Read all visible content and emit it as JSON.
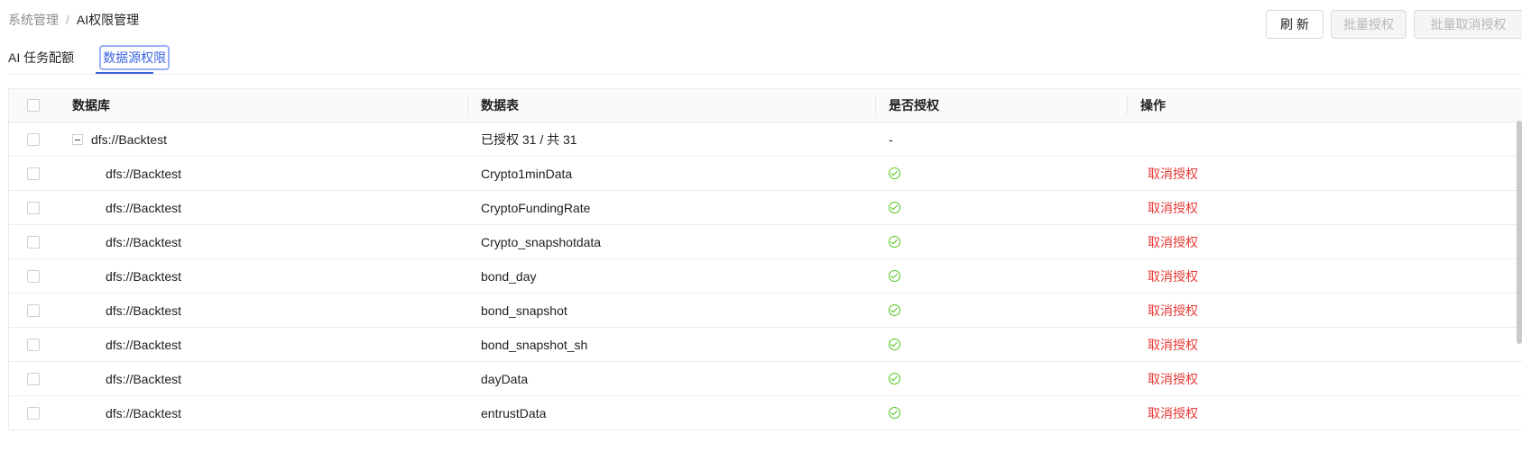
{
  "breadcrumb": {
    "parent": "系统管理",
    "separator": "/",
    "current": "AI权限管理"
  },
  "toolbar": {
    "refresh_label": "刷 新",
    "batch_grant_label": "批量授权",
    "batch_revoke_label": "批量取消授权"
  },
  "tabs": [
    {
      "label": "AI 任务配额",
      "active": false
    },
    {
      "label": "数据源权限",
      "active": true
    }
  ],
  "table": {
    "headers": {
      "database": "数据库",
      "table": "数据表",
      "authorized": "是否授权",
      "operation": "操作"
    },
    "group": {
      "database": "dfs://Backtest",
      "summary": "已授权 31 / 共 31",
      "authorized": "-"
    },
    "rows": [
      {
        "database": "dfs://Backtest",
        "table": "Crypto1minData",
        "op": "取消授权"
      },
      {
        "database": "dfs://Backtest",
        "table": "CryptoFundingRate",
        "op": "取消授权"
      },
      {
        "database": "dfs://Backtest",
        "table": "Crypto_snapshotdata",
        "op": "取消授权"
      },
      {
        "database": "dfs://Backtest",
        "table": "bond_day",
        "op": "取消授权"
      },
      {
        "database": "dfs://Backtest",
        "table": "bond_snapshot",
        "op": "取消授权"
      },
      {
        "database": "dfs://Backtest",
        "table": "bond_snapshot_sh",
        "op": "取消授权"
      },
      {
        "database": "dfs://Backtest",
        "table": "dayData",
        "op": "取消授权"
      },
      {
        "database": "dfs://Backtest",
        "table": "entrustData",
        "op": "取消授权"
      }
    ]
  },
  "colors": {
    "accent": "#3b63e0",
    "danger": "#e53935",
    "success": "#52c41a"
  }
}
